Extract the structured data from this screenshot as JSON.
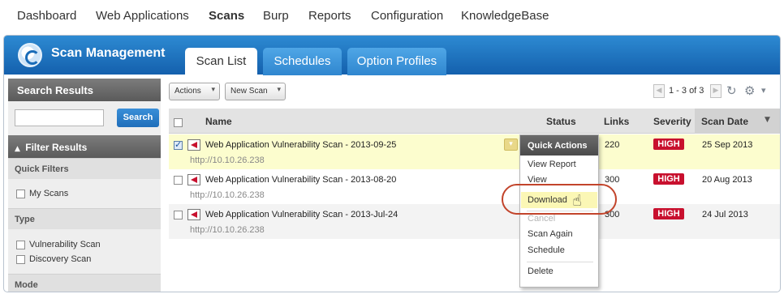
{
  "topnav": {
    "items": [
      "Dashboard",
      "Web Applications",
      "Scans",
      "Burp",
      "Reports",
      "Configuration",
      "KnowledgeBase"
    ],
    "active": "Scans"
  },
  "header": {
    "title": "Scan Management",
    "tabs": [
      "Scan List",
      "Schedules",
      "Option Profiles"
    ],
    "active_tab": "Scan List"
  },
  "sidebar": {
    "search_heading": "Search Results",
    "search_button": "Search",
    "search_value": "",
    "filter_heading": "Filter Results",
    "filter_caret": "▲",
    "quick_filters_label": "Quick Filters",
    "my_scans_label": "My Scans",
    "type_label": "Type",
    "vuln_scan_label": "Vulnerability Scan",
    "discovery_scan_label": "Discovery Scan",
    "mode_label": "Mode"
  },
  "toolbar": {
    "actions_label": "Actions",
    "new_scan_label": "New Scan",
    "pagination": "1 - 3 of 3",
    "chevron": "▾"
  },
  "table": {
    "columns": [
      "Name",
      "Status",
      "Links",
      "Severity",
      "Scan Date"
    ],
    "sort_indicator": "▼",
    "rows": [
      {
        "name": "Web Application Vulnerability Scan - 2013-09-25",
        "url": "http://10.10.26.238",
        "links": "220",
        "severity": "HIGH",
        "date": "25 Sep 2013",
        "selected": true
      },
      {
        "name": "Web Application Vulnerability Scan - 2013-08-20",
        "url": "http://10.10.26.238",
        "links": "300",
        "severity": "HIGH",
        "date": "20 Aug 2013",
        "selected": false
      },
      {
        "name": "Web Application Vulnerability Scan - 2013-Jul-24",
        "url": "http://10.10.26.238",
        "links": "300",
        "severity": "HIGH",
        "date": "24 Jul 2013",
        "selected": false
      }
    ]
  },
  "quick_actions": {
    "title": "Quick Actions",
    "items": [
      "View Report",
      "View",
      "Download",
      "Cancel",
      "Scan Again",
      "Schedule",
      "Delete"
    ],
    "highlighted": "Download",
    "disabled": [
      "Cancel"
    ]
  },
  "colors": {
    "header_blue": "#1f74c2",
    "severity_high": "#c8102e",
    "selected_row": "#fcfdce",
    "callout_ring": "#c2442b"
  },
  "icons": {
    "logo": "qualys-logo-icon",
    "refresh": "↻",
    "gear": "⚙",
    "cursor": "☝"
  }
}
